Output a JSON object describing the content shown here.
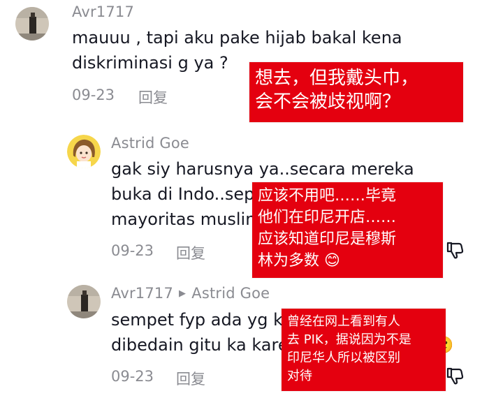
{
  "comments": [
    {
      "username": "Avr1717",
      "lines": [
        "mauuu , tapi aku pake hijab bakal kena",
        "diskriminasi g ya ?"
      ],
      "date": "09-23",
      "reply_label": "回复",
      "translation": [
        "想去，但我戴头巾，",
        "会不会被歧视啊？"
      ]
    },
    {
      "username": "Astrid Goe",
      "lines": [
        "gak siy harusnya ya..secara mereka",
        "buka di Indo..seperti juga tau kalo",
        "mayoritas muslim di Indo"
      ],
      "date": "09-23",
      "reply_label": "回复",
      "translation": [
        "应该不用吧……毕竟",
        "他们在印尼开店……",
        "应该知道印尼是穆斯",
        "林为多数 😊"
      ]
    },
    {
      "username": "Avr1717",
      "reply_to": "Astrid Goe",
      "lines": [
        "sempet fyp ada yg komen di PIK gitu ya",
        "dibedain gitu ka karena bukan chindo 🥲"
      ],
      "date": "09-23",
      "reply_label": "回复",
      "translation": [
        "曾经在网上看到有人",
        "去 PIK，据说因为不是",
        "印尼华人所以被区别",
        "对待"
      ]
    }
  ],
  "colors": {
    "overlay_red": "#e4000f",
    "meta_gray": "#8a8b91",
    "text": "#161823"
  }
}
